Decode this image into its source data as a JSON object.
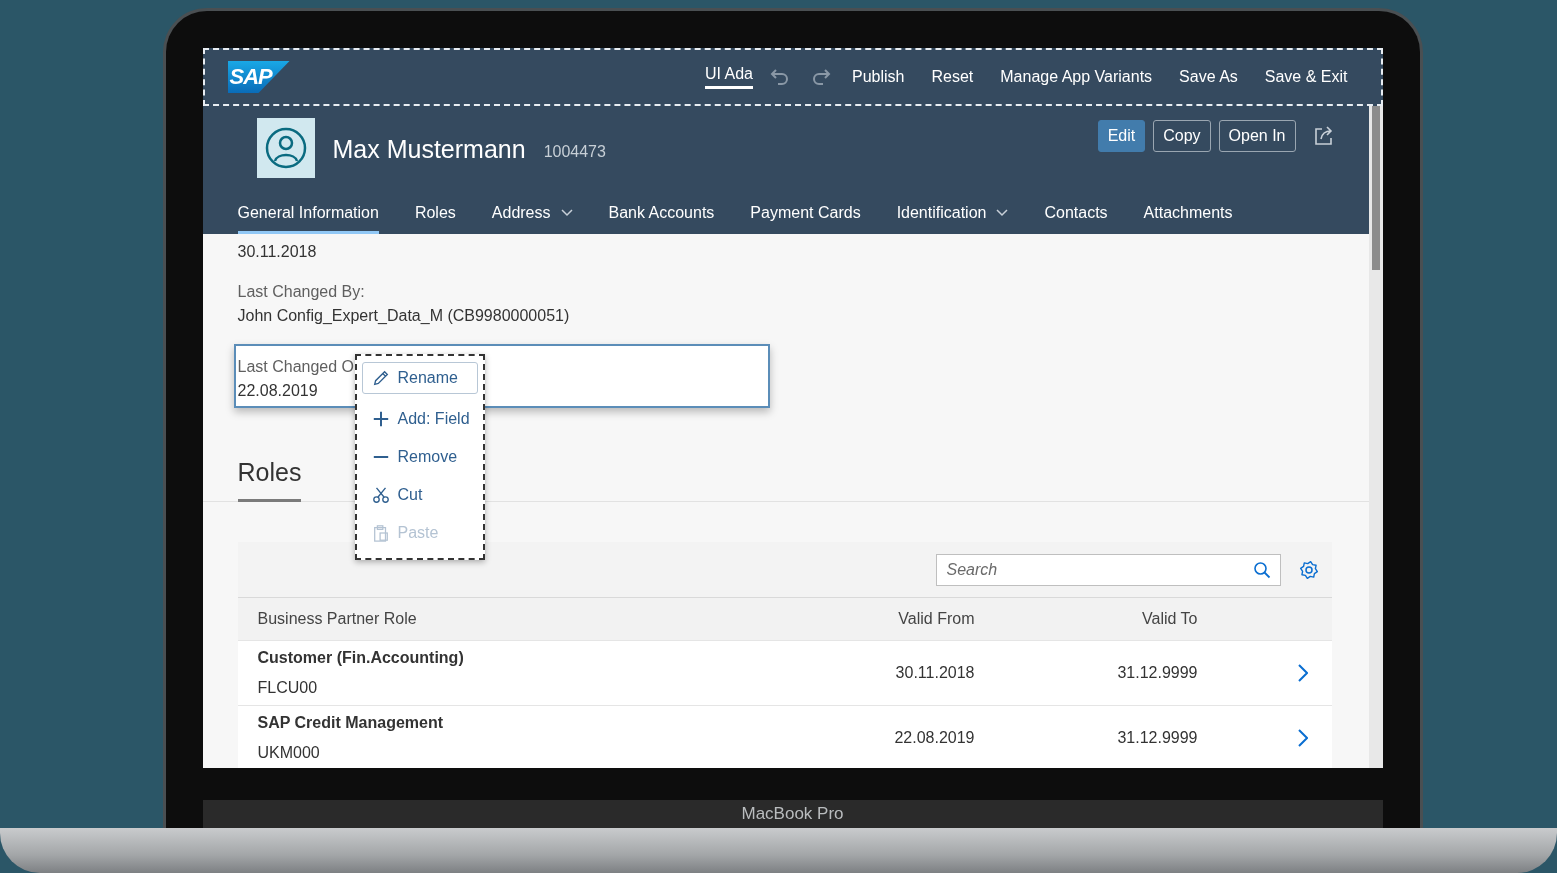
{
  "device": {
    "label": "MacBook Pro"
  },
  "shell": {
    "logo": "SAP",
    "mode_tab": {
      "label": "UI Ada",
      "selected": true
    },
    "actions": [
      "Publish",
      "Reset",
      "Manage App Variants",
      "Save As",
      "Save & Exit"
    ]
  },
  "header": {
    "name": "Max Mustermann",
    "id": "1004473",
    "buttons": [
      {
        "label": "Edit",
        "emphasized": true
      },
      {
        "label": "Copy",
        "emphasized": false
      },
      {
        "label": "Open In",
        "emphasized": false
      }
    ]
  },
  "tabs": [
    {
      "label": "General Information",
      "selected": true,
      "has_menu": false
    },
    {
      "label": "Roles",
      "selected": false,
      "has_menu": false
    },
    {
      "label": "Address",
      "selected": false,
      "has_menu": true
    },
    {
      "label": "Bank Accounts",
      "selected": false,
      "has_menu": false
    },
    {
      "label": "Payment Cards",
      "selected": false,
      "has_menu": false
    },
    {
      "label": "Identification",
      "selected": false,
      "has_menu": true
    },
    {
      "label": "Contacts",
      "selected": false,
      "has_menu": false
    },
    {
      "label": "Attachments",
      "selected": false,
      "has_menu": false
    }
  ],
  "fields": [
    {
      "value": "30.11.2018",
      "selected": false
    },
    {
      "label": "Last Changed By:",
      "value": "John Config_Expert_Data_M (CB9980000051)",
      "selected": false
    },
    {
      "label": "Last Changed O",
      "value": "22.08.2019",
      "selected": true
    }
  ],
  "context_menu": {
    "items": [
      {
        "kind": "rename",
        "label": "Rename",
        "selected": true,
        "disabled": false
      },
      {
        "kind": "add",
        "label": "Add: Field",
        "selected": false,
        "disabled": false
      },
      {
        "kind": "remove",
        "label": "Remove",
        "selected": false,
        "disabled": false
      },
      {
        "kind": "cut",
        "label": "Cut",
        "selected": false,
        "disabled": false
      },
      {
        "kind": "paste",
        "label": "Paste",
        "selected": false,
        "disabled": true
      }
    ]
  },
  "section": {
    "title": "Roles"
  },
  "table": {
    "search": {
      "placeholder": "Search"
    },
    "columns": [
      "Business Partner Role",
      "Valid From",
      "Valid To"
    ],
    "rows": [
      {
        "role": "Customer (Fin.Accounting)",
        "code": "FLCU00",
        "valid_from": "30.11.2018",
        "valid_to": "31.12.9999"
      },
      {
        "role": "SAP Credit Management",
        "code": "UKM000",
        "valid_from": "22.08.2019",
        "valid_to": "31.12.9999"
      }
    ]
  }
}
